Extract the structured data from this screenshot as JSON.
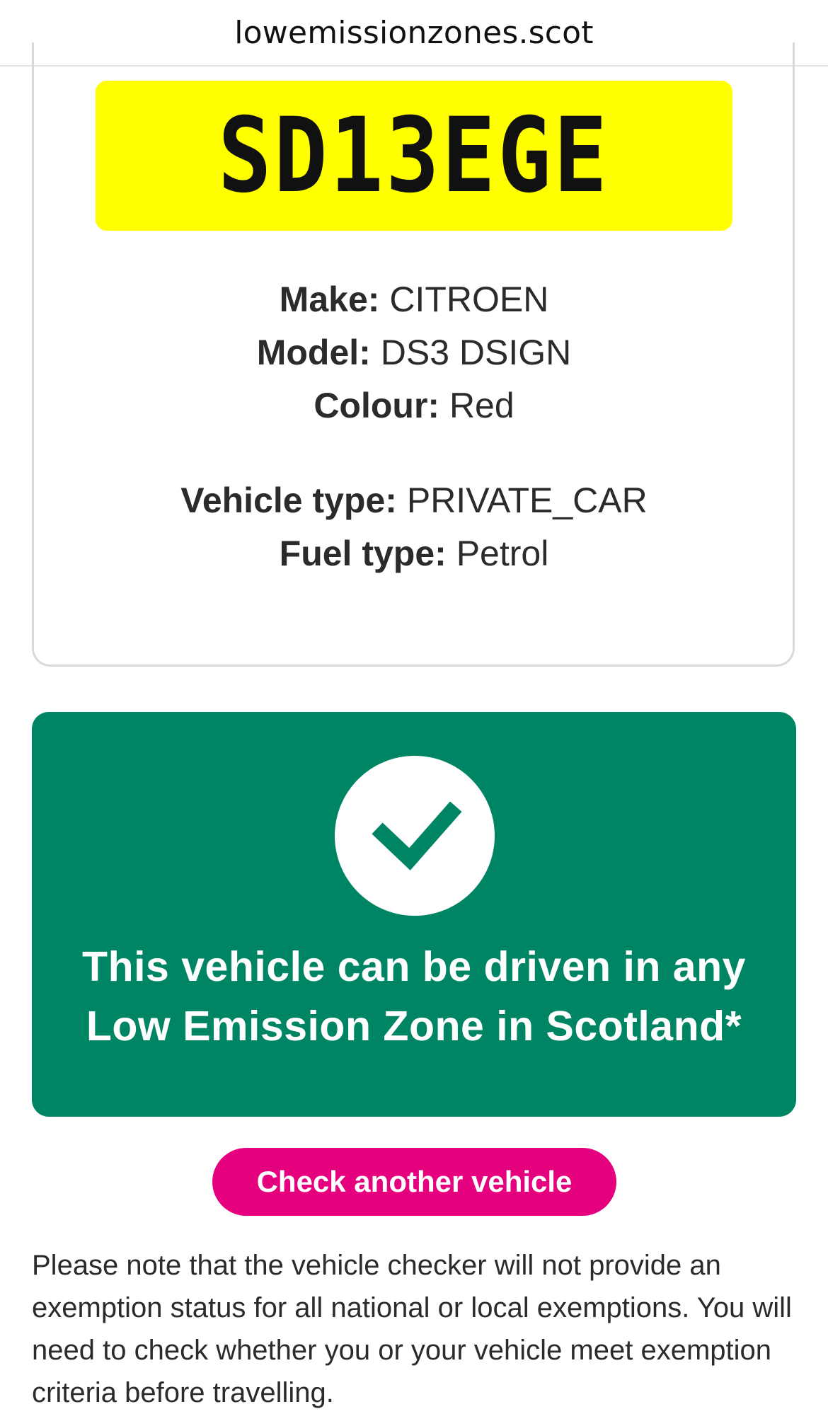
{
  "browser": {
    "url": "lowemissionzones.scot"
  },
  "vehicle": {
    "registration": "SD13EGE",
    "make_label": "Make:",
    "make": "CITROEN",
    "model_label": "Model:",
    "model": "DS3 DSIGN",
    "colour_label": "Colour:",
    "colour": "Red",
    "vehicle_type_label": "Vehicle type:",
    "vehicle_type": "PRIVATE_CAR",
    "fuel_type_label": "Fuel type:",
    "fuel_type": "Petrol"
  },
  "result": {
    "line1": "This vehicle can be driven in any",
    "line2": "Low Emission Zone in Scotland*",
    "icon": "checkmark-icon",
    "color": "#008564"
  },
  "actions": {
    "check_another_label": "Check another vehicle",
    "color": "#e5007e"
  },
  "note": "Please note that the vehicle checker will not provide an exemption status for all national or local exemptions. You will need to check whether you or your vehicle meet exemption criteria before travelling."
}
